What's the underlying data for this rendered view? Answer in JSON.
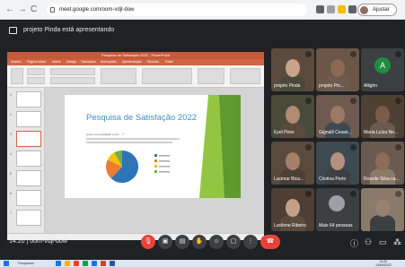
{
  "browser": {
    "url": "meet.google.com/oom-vdjl-dow",
    "profile_label": "Ajustar",
    "nav": [
      "←",
      "→",
      "C"
    ]
  },
  "meet": {
    "presenting_text": "projeto Pinda está apresentando",
    "meeting_time": "14:20",
    "meeting_code": "oom-vdjl-dow"
  },
  "powerpoint": {
    "window_title": "Pesquisa de Satisfação 2022 - PowerPoint",
    "tabs": [
      "Arquivo",
      "Página Inicial",
      "Inserir",
      "Design",
      "Transições",
      "Animações",
      "Apresentação",
      "Revisão",
      "Exibir"
    ],
    "thumbnail_numbers": [
      "1",
      "2",
      "3",
      "4",
      "5",
      "6",
      "7"
    ],
    "slide_title": "Pesquisa de Satisfação 2022",
    "slide_text": "Qual a sua avaliação sobre ... ?"
  },
  "chart_data": {
    "type": "pie",
    "title": "",
    "series": [
      {
        "name": "",
        "values": [
          62,
          20,
          10,
          8
        ]
      }
    ],
    "colors": [
      "#2e75b6",
      "#ed7d31",
      "#ffc000",
      "#70ad47"
    ]
  },
  "participants": [
    {
      "name": "projeto Pinda"
    },
    {
      "name": "projeto Pin..."
    },
    {
      "name": "Allighn",
      "initial": "A"
    },
    {
      "name": "Eyel Pires"
    },
    {
      "name": "Gignalli Cesari..."
    },
    {
      "name": "Maria Luíza Ne..."
    },
    {
      "name": "Lucimar Bica..."
    },
    {
      "name": "Cristina Porto"
    },
    {
      "name": "Roselle Silva ca..."
    },
    {
      "name": "Lucilene Ribeiro"
    },
    {
      "name": "Mais 64 pessoas"
    },
    {
      "name": ""
    }
  ],
  "taskbar": {
    "search_label": "Pesquisar",
    "time": "14:20",
    "date": "13/09/2022"
  },
  "colors": {
    "meet_bg": "#202124",
    "ppt_accent": "#d06544",
    "slide_title": "#3d8fc6",
    "end_call": "#ea4335",
    "slide_green": "#92c642"
  }
}
